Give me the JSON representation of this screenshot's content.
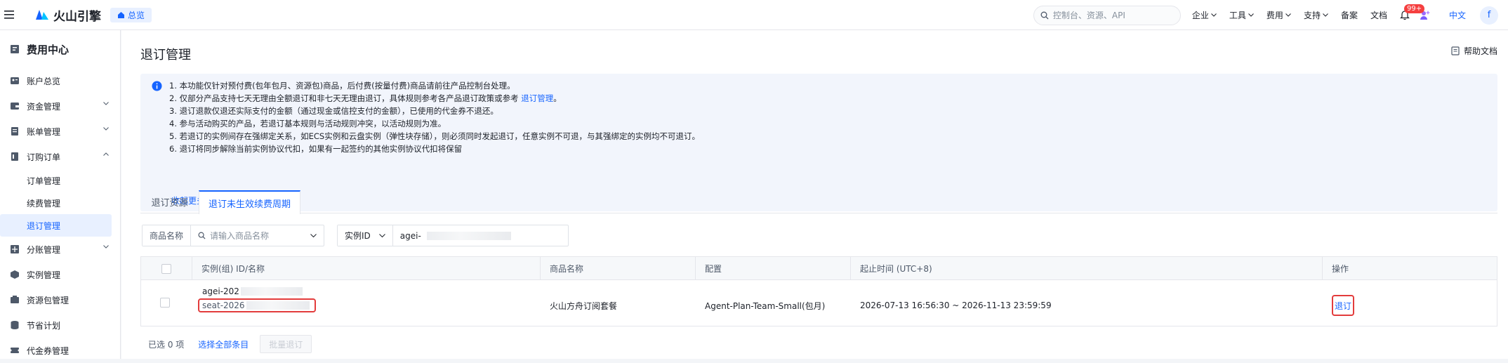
{
  "topbar": {
    "logo_text": "火山引擎",
    "overview_label": "总览",
    "search_placeholder": "控制台、资源、API",
    "menus": [
      "企业",
      "工具",
      "费用",
      "支持"
    ],
    "plain_links": [
      "备案",
      "文档"
    ],
    "notification_badge": "99+",
    "language": "中文",
    "avatar_initial": "f"
  },
  "sidebar": {
    "title": "费用中心",
    "items": [
      {
        "label": "账户总览",
        "icon": "user-card-icon",
        "expandable": false
      },
      {
        "label": "资金管理",
        "icon": "wallet-icon",
        "expandable": true,
        "expanded": false
      },
      {
        "label": "账单管理",
        "icon": "bill-icon",
        "expandable": true,
        "expanded": false
      },
      {
        "label": "订购订单",
        "icon": "order-icon",
        "expandable": true,
        "expanded": true
      }
    ],
    "subitems": [
      {
        "label": "订单管理",
        "active": false
      },
      {
        "label": "续费管理",
        "active": false
      },
      {
        "label": "退订管理",
        "active": true
      }
    ],
    "items_after": [
      {
        "label": "分账管理",
        "icon": "split-icon",
        "expandable": true
      },
      {
        "label": "实例管理",
        "icon": "cube-icon",
        "expandable": false
      },
      {
        "label": "资源包管理",
        "icon": "package-icon",
        "expandable": false
      },
      {
        "label": "节省计划",
        "icon": "database-icon",
        "expandable": false
      },
      {
        "label": "代金券管理",
        "icon": "coupon-icon",
        "expandable": false
      }
    ]
  },
  "page": {
    "title": "退订管理",
    "help_doc": "帮助文档"
  },
  "notice": {
    "lines": [
      "1. 本功能仅针对预付费(包年包月、资源包)商品，后付费(按量付费)商品请前往产品控制台处理。",
      "2. 仅部分产品支持七天无理由全额退订和非七天无理由退订，具体规则参考各产品退订政策或参考",
      "3. 退订退款仅退还实际支付的金额（通过现金或信控支付的金额），已使用的代金券不退还。",
      "4. 参与活动购买的产品，若退订基本规则与活动规则冲突，以活动规则为准。",
      "5. 若退订的实例间存在强绑定关系，如ECS实例和云盘实例（弹性块存储），则必须同时发起退订，任意实例不可退，与其强绑定的实例均不可退订。",
      "6. 退订将同步解除当前实例协议代扣，如果有一起签约的其他实例协议代扣将保留"
    ],
    "line2_link": "退订管理",
    "line2_suffix": "。",
    "collapse_label": "收起更多"
  },
  "tabs": [
    {
      "label": "退订资源",
      "active": false
    },
    {
      "label": "退订未生效续费周期",
      "active": true
    }
  ],
  "filters": {
    "product_label": "商品名称",
    "product_placeholder": "请输入商品名称",
    "instance_select": "实例ID",
    "instance_value": "agei-"
  },
  "table": {
    "columns": [
      "实例(组) ID/名称",
      "商品名称",
      "配置",
      "起止时间 (UTC+8)",
      "操作"
    ],
    "rows": [
      {
        "instance_id": "agei-202",
        "instance_name": "seat-2026",
        "product": "火山方舟订阅套餐",
        "config": "Agent-Plan-Team-Small(包月)",
        "period": "2026-07-13 16:56:30 ~ 2026-11-13 23:59:59",
        "action": "退订"
      }
    ]
  },
  "footer": {
    "selected": "已选 0 项",
    "select_all": "选择全部条目",
    "batch": "批量退订"
  },
  "colors": {
    "accent": "#1664ff",
    "highlight_box": "#e33c3c"
  }
}
